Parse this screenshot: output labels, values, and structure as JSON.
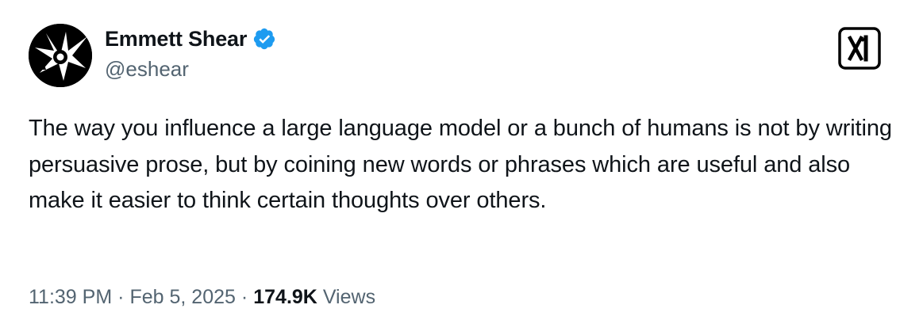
{
  "author": {
    "display_name": "Emmett Shear",
    "handle": "@eshear",
    "verified": true,
    "avatar_icon": "starburst-avatar-icon",
    "verified_color": "#1d9bf0"
  },
  "brand": {
    "logo_icon": "x-logo-icon"
  },
  "tweet": {
    "text": "The way you influence a large language model or a bunch of humans is not by writing persuasive prose, but by coining new words or phrases which are useful and also make it easier to think certain thoughts over others.",
    "time": "11:39 PM",
    "separator": "·",
    "date": "Feb 5, 2025",
    "views_count": "174.9K",
    "views_label": "Views"
  },
  "colors": {
    "text_primary": "#0f1419",
    "text_secondary": "#536471"
  }
}
